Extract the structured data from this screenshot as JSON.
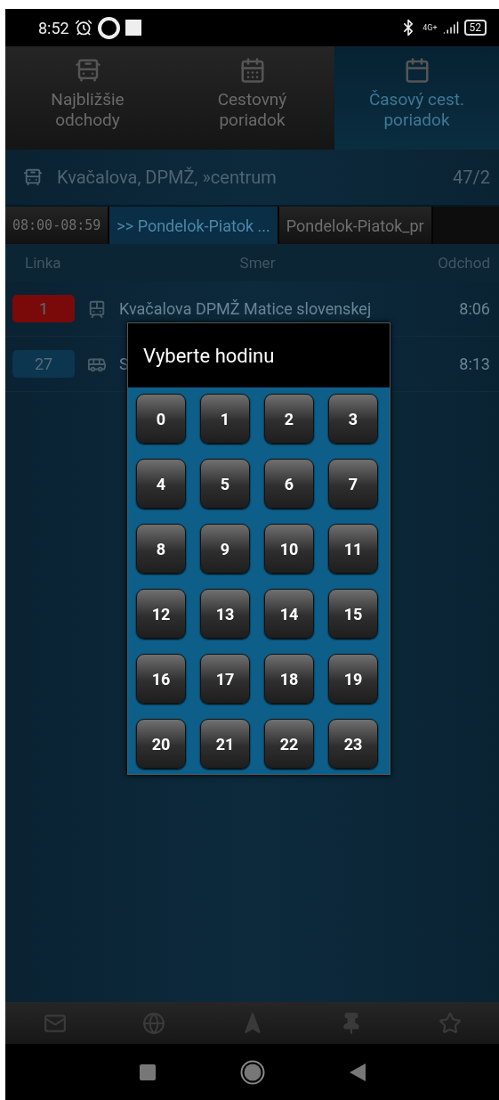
{
  "status_bar": {
    "time": "8:52",
    "network": "4G+",
    "battery": "52"
  },
  "tabs": [
    {
      "label": "Najbližšie odchody",
      "selected": false
    },
    {
      "label": "Cestovný poriadok",
      "selected": false
    },
    {
      "label": "Časový cest. poriadok",
      "selected": true
    }
  ],
  "station": {
    "name": "Kvačalova, DPMŽ, »centrum",
    "count": "47/2"
  },
  "filters": [
    {
      "label": "08:00-08:59",
      "selected": false
    },
    {
      "label": ">> Pondelok-Piatok ...",
      "selected": true
    },
    {
      "label": "Pondelok-Piatok_pr",
      "selected": false
    }
  ],
  "table": {
    "columns": [
      "Linka",
      "Smer",
      "Odchod"
    ],
    "rows": [
      {
        "line": "1",
        "color": "#7a0a0a",
        "kind": "trolleybus",
        "direction": "Kvačalova DPMŽ Matice slovenskej",
        "departure": "8:06"
      },
      {
        "line": "27",
        "color": "#0c3550",
        "kind": "bus",
        "direction": "S",
        "departure": "8:13"
      }
    ]
  },
  "dialog": {
    "title": "Vyberte hodinu",
    "hours": [
      "0",
      "1",
      "2",
      "3",
      "4",
      "5",
      "6",
      "7",
      "8",
      "9",
      "10",
      "11",
      "12",
      "13",
      "14",
      "15",
      "16",
      "17",
      "18",
      "19",
      "20",
      "21",
      "22",
      "23"
    ]
  }
}
